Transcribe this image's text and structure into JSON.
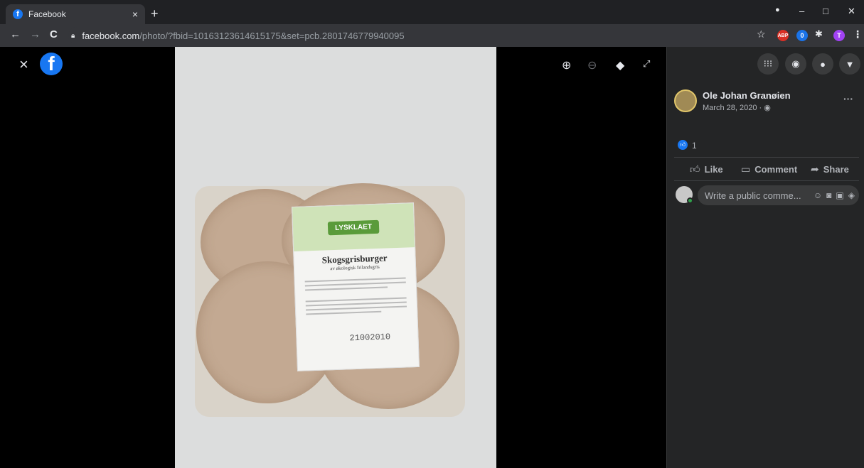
{
  "browser": {
    "tab_title": "Facebook",
    "tab_close": "×",
    "new_tab": "+",
    "minimize": "–",
    "maximize": "□",
    "close": "✕",
    "back": "←",
    "forward": "→",
    "reload": "C",
    "url_host": "facebook.com",
    "url_path": "/photo/?fbid=10163123614615175&set=pcb.2801746779940095",
    "bookmark_icon": "star-icon",
    "extensions": [
      "ABP",
      "0",
      "T"
    ]
  },
  "viewer": {
    "close_label": "×",
    "logo": "f",
    "tools": [
      "zoom-in-icon",
      "zoom-out-icon",
      "tag-icon",
      "fullscreen-icon"
    ],
    "product": {
      "brand": "LYSKLAET",
      "name": "Skogsgrisburger",
      "subtitle": "av økologisk frilandsgris",
      "code": "21002010"
    }
  },
  "panel": {
    "author": "Ole Johan Granøien",
    "date": "March 28, 2020 ·",
    "more": "···",
    "like_count": "1",
    "actions": {
      "like": "Like",
      "comment": "Comment",
      "share": "Share"
    },
    "comment_placeholder": "Write a public comme..."
  }
}
